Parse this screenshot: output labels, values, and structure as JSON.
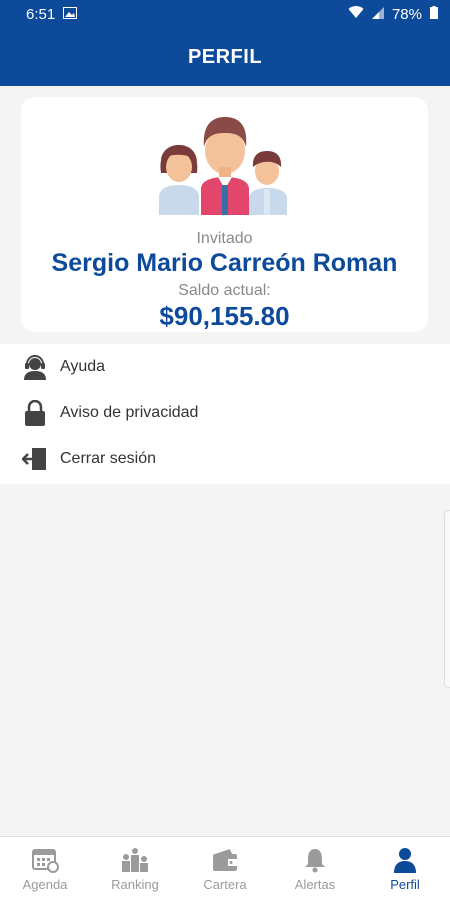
{
  "status_bar": {
    "time": "6:51",
    "battery": "78%"
  },
  "header": {
    "title": "PERFIL"
  },
  "profile": {
    "role": "Invitado",
    "name": "Sergio Mario Carreón Roman",
    "balance_label": "Saldo actual:",
    "balance": "$90,155.80"
  },
  "menu": {
    "items": [
      {
        "label": "Ayuda",
        "icon": "headset-icon"
      },
      {
        "label": "Aviso de privacidad",
        "icon": "lock-icon"
      },
      {
        "label": "Cerrar sesión",
        "icon": "logout-icon"
      }
    ]
  },
  "bottom_nav": {
    "active": "Perfil",
    "items": [
      {
        "label": "Agenda",
        "icon": "calendar-icon"
      },
      {
        "label": "Ranking",
        "icon": "ranking-icon"
      },
      {
        "label": "Cartera",
        "icon": "wallet-icon"
      },
      {
        "label": "Alertas",
        "icon": "bell-icon"
      },
      {
        "label": "Perfil",
        "icon": "user-icon"
      }
    ]
  },
  "colors": {
    "primary": "#0d4a9a",
    "muted": "#9b9b9b",
    "background": "#f4f4f4"
  }
}
